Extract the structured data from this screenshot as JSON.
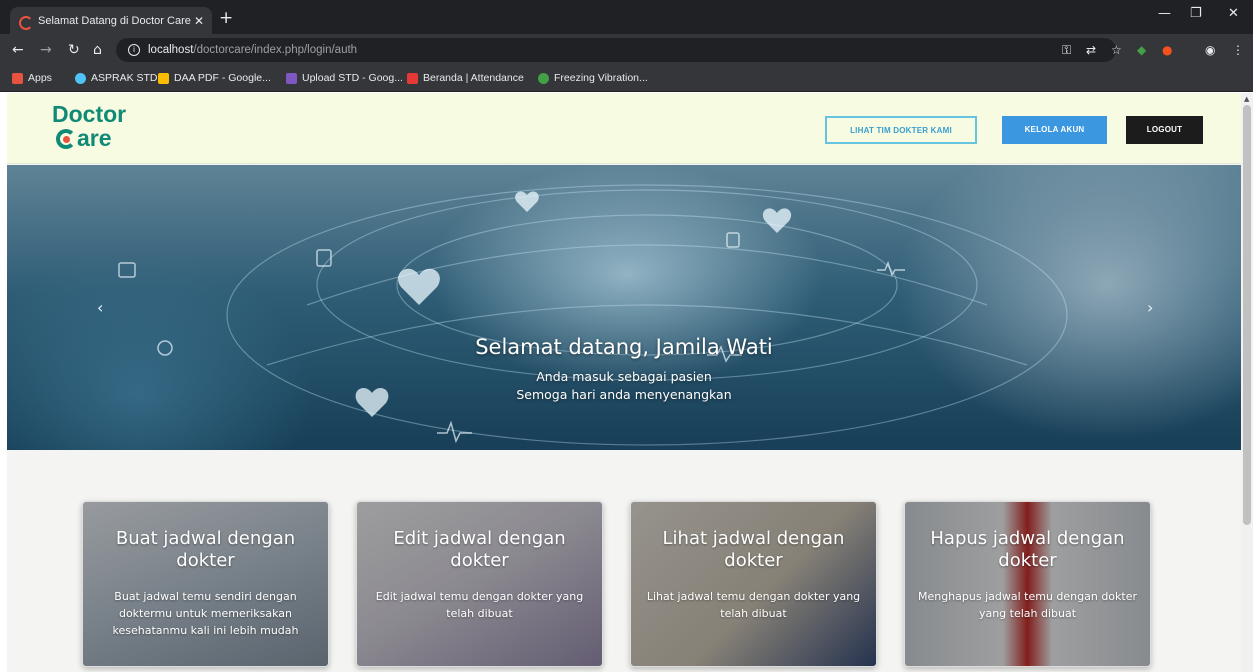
{
  "browser": {
    "tab_title": "Selamat Datang di Doctor Care",
    "url_host": "localhost",
    "url_path": "/doctorcare/index.php/login/auth",
    "bookmarks": [
      {
        "label": "Apps",
        "color": "#e8533f"
      },
      {
        "label": "ASPRAK STD",
        "color": "#4fc3f7"
      },
      {
        "label": "DAA PDF - Google...",
        "color": "#fbbc04"
      },
      {
        "label": "Upload STD - Goog...",
        "color": "#7e57c2"
      },
      {
        "label": "Beranda | Attendance",
        "color": "#e53935"
      },
      {
        "label": "Freezing Vibration...",
        "color": "#43a047"
      }
    ]
  },
  "header": {
    "logo_line1": "Doctor",
    "logo_line2": "are",
    "btn_team": "LIHAT TIM DOKTER KAMI",
    "btn_account": "KELOLA AKUN",
    "btn_logout": "LOGOUT"
  },
  "hero": {
    "title": "Selamat datang, Jamila Wati",
    "line1": "Anda masuk sebagai pasien",
    "line2": "Semoga hari anda menyenangkan",
    "prev": "‹",
    "next": "›"
  },
  "cards": [
    {
      "title": "Buat jadwal dengan dokter",
      "desc": "Buat jadwal temu sendiri dengan doktermu untuk memeriksakan kesehatanmu kali ini lebih mudah"
    },
    {
      "title": "Edit jadwal dengan dokter",
      "desc": "Edit jadwal temu dengan dokter yang telah dibuat"
    },
    {
      "title": "Lihat jadwal dengan dokter",
      "desc": "Lihat jadwal temu dengan dokter yang telah dibuat"
    },
    {
      "title": "Hapus jadwal dengan dokter",
      "desc": "Menghapus jadwal temu dengan dokter yang telah dibuat"
    }
  ]
}
